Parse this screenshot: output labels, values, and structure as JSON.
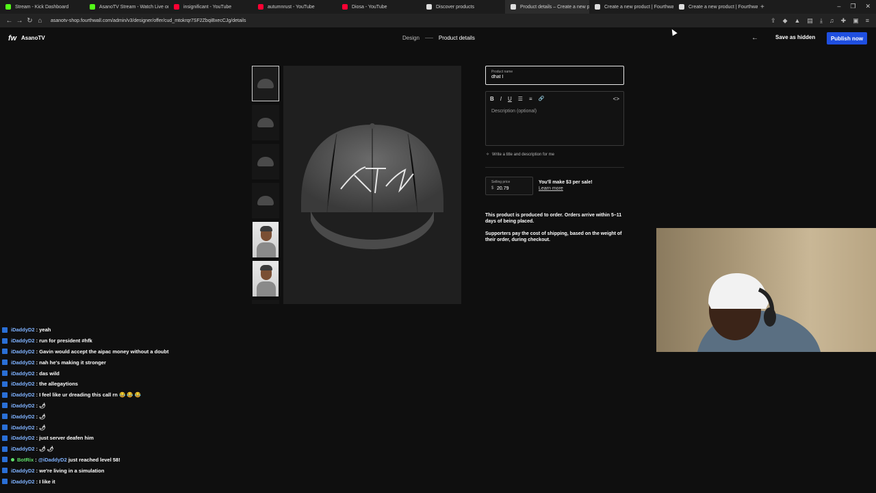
{
  "browser": {
    "tabs": [
      {
        "title": "Stream - Kick Dashboard",
        "favicon_color": "#53fc18"
      },
      {
        "title": "AsanoTV Stream - Watch Live on Kick",
        "favicon_color": "#53fc18"
      },
      {
        "title": "insignificant - YouTube",
        "favicon_color": "#ff0033"
      },
      {
        "title": "autumnrust - YouTube",
        "favicon_color": "#ff0033"
      },
      {
        "title": "Diosa - YouTube",
        "favicon_color": "#ff0033"
      },
      {
        "title": "Discover products",
        "favicon_color": "#dddddd"
      },
      {
        "title": "Product details – Create a new p",
        "favicon_color": "#dddddd",
        "active": true
      },
      {
        "title": "Create a new product | Fourthwall",
        "favicon_color": "#dddddd"
      },
      {
        "title": "Create a new product | Fourthwall",
        "favicon_color": "#dddddd"
      }
    ],
    "url": "asanotv-shop.fourthwall.com/admin/v3/designer/offer/cud_mtokrqr7SF2ZbqiBxecCJg/details"
  },
  "app": {
    "logo": "fw",
    "brand": "AsanoTV",
    "steps": {
      "design": "Design",
      "details": "Product details"
    },
    "save_hidden": "Save as hidden",
    "publish": "Publish now"
  },
  "form": {
    "name_label": "Product name",
    "name_value": "dhat l",
    "description_placeholder": "Description (optional)",
    "toolbar": {
      "bold": "B",
      "italic": "I",
      "underline": "U",
      "bullets": "☰",
      "numbered": "≡",
      "link": "🔗",
      "code": "<>"
    },
    "ai_write": "Write a title and description for me",
    "price_label": "Selling price",
    "currency": "$",
    "price_value": "20.79",
    "earn_text": "You'll make $3 per sale!",
    "learn_more": "Learn more",
    "info_production": "This product is produced to order. Orders arrive within 5–11 days of being placed.",
    "info_shipping": "Supporters pay the cost of shipping, based on the weight of their order, during checkout."
  },
  "chat": [
    {
      "user": "iDaddyD2",
      "text": "yeah"
    },
    {
      "user": "iDaddyD2",
      "text": "run for president #hfk"
    },
    {
      "user": "iDaddyD2",
      "text": "Gavin would accept the aipac money without a doubt"
    },
    {
      "user": "iDaddyD2",
      "text": "nah he's making it stronger"
    },
    {
      "user": "iDaddyD2",
      "text": "das wild"
    },
    {
      "user": "iDaddyD2",
      "text": "the allegaytions"
    },
    {
      "user": "iDaddyD2",
      "text": "I feel like ur dreading this call rn 😂 😂 😂"
    },
    {
      "user": "iDaddyD2",
      "text": "🌶"
    },
    {
      "user": "iDaddyD2",
      "text": "🌶"
    },
    {
      "user": "iDaddyD2",
      "text": "🌶"
    },
    {
      "user": "iDaddyD2",
      "text": "just server deafen him"
    },
    {
      "user": "iDaddyD2",
      "text": "🌶 🌶"
    },
    {
      "user": "BotRix",
      "bot": true,
      "mention": "@iDaddyD2",
      "text": "just reached level 58!"
    },
    {
      "user": "iDaddyD2",
      "text": "we're living in a simulation"
    },
    {
      "user": "iDaddyD2",
      "text": "I like it"
    }
  ]
}
